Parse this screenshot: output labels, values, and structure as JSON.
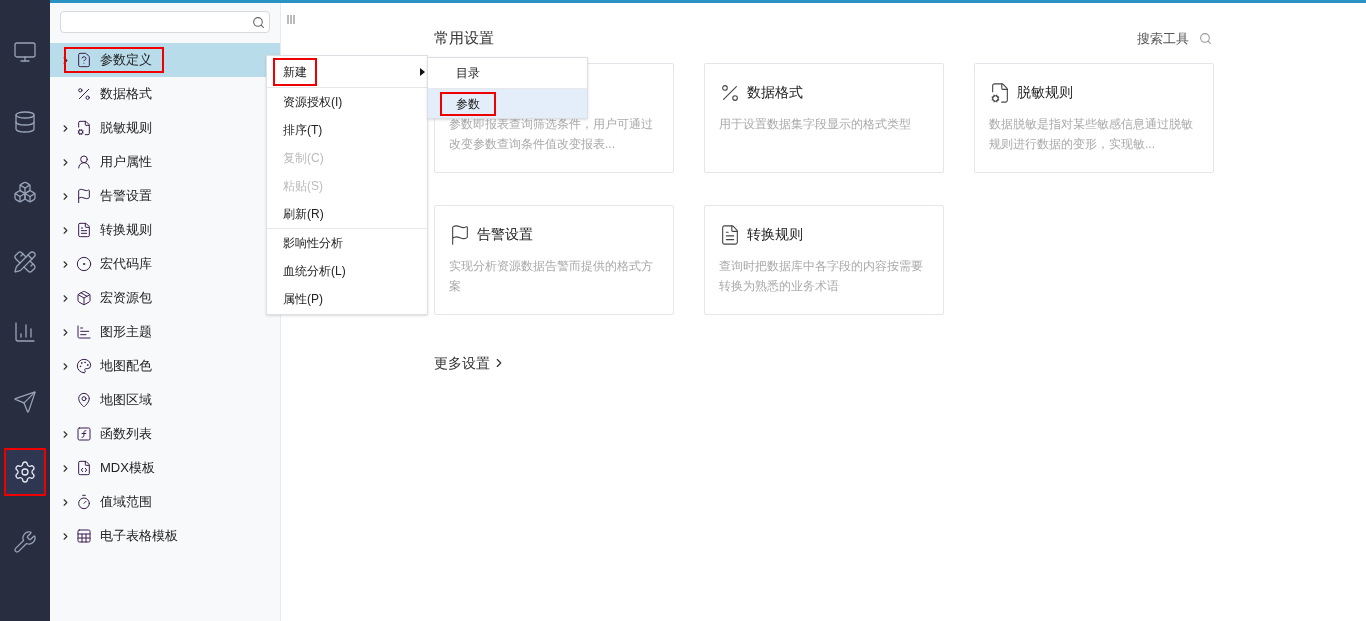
{
  "rail": [
    {
      "selected": false,
      "highlighted": false
    },
    {
      "selected": false,
      "highlighted": false
    },
    {
      "selected": false,
      "highlighted": false
    },
    {
      "selected": false,
      "highlighted": false
    },
    {
      "selected": false,
      "highlighted": false
    },
    {
      "selected": false,
      "highlighted": false
    },
    {
      "selected": true,
      "highlighted": true
    },
    {
      "selected": false,
      "highlighted": false
    }
  ],
  "tree": {
    "items": [
      {
        "label": "参数定义",
        "expandable": true,
        "selected": true,
        "highlighted": true
      },
      {
        "label": "数据格式",
        "expandable": false,
        "selected": false,
        "highlighted": false
      },
      {
        "label": "脱敏规则",
        "expandable": true,
        "selected": false,
        "highlighted": false
      },
      {
        "label": "用户属性",
        "expandable": true,
        "selected": false,
        "highlighted": false
      },
      {
        "label": "告警设置",
        "expandable": true,
        "selected": false,
        "highlighted": false
      },
      {
        "label": "转换规则",
        "expandable": true,
        "selected": false,
        "highlighted": false
      },
      {
        "label": "宏代码库",
        "expandable": true,
        "selected": false,
        "highlighted": false
      },
      {
        "label": "宏资源包",
        "expandable": true,
        "selected": false,
        "highlighted": false
      },
      {
        "label": "图形主题",
        "expandable": true,
        "selected": false,
        "highlighted": false
      },
      {
        "label": "地图配色",
        "expandable": true,
        "selected": false,
        "highlighted": false
      },
      {
        "label": "地图区域",
        "expandable": false,
        "selected": false,
        "highlighted": false
      },
      {
        "label": "函数列表",
        "expandable": true,
        "selected": false,
        "highlighted": false
      },
      {
        "label": "MDX模板",
        "expandable": true,
        "selected": false,
        "highlighted": false
      },
      {
        "label": "值域范围",
        "expandable": true,
        "selected": false,
        "highlighted": false
      },
      {
        "label": "电子表格模板",
        "expandable": true,
        "selected": false,
        "highlighted": false
      }
    ]
  },
  "context_menu": {
    "groups": [
      [
        {
          "label": "新建",
          "disabled": false,
          "highlighted": true,
          "submenu": true
        }
      ],
      [
        {
          "label": "资源授权(I)",
          "disabled": false,
          "highlighted": false,
          "submenu": false
        },
        {
          "label": "排序(T)",
          "disabled": false,
          "highlighted": false,
          "submenu": false
        },
        {
          "label": "复制(C)",
          "disabled": true,
          "highlighted": false,
          "submenu": false
        },
        {
          "label": "粘贴(S)",
          "disabled": true,
          "highlighted": false,
          "submenu": false
        },
        {
          "label": "刷新(R)",
          "disabled": false,
          "highlighted": false,
          "submenu": false
        }
      ],
      [
        {
          "label": "影响性分析",
          "disabled": false,
          "highlighted": false,
          "submenu": false
        },
        {
          "label": "血统分析(L)",
          "disabled": false,
          "highlighted": false,
          "submenu": false
        },
        {
          "label": "属性(P)",
          "disabled": false,
          "highlighted": false,
          "submenu": false
        }
      ]
    ]
  },
  "submenu": [
    {
      "label": "目录",
      "selected": false,
      "highlighted": false
    },
    {
      "label": "参数",
      "selected": true,
      "highlighted": true
    }
  ],
  "main": {
    "title": "常用设置",
    "search_label": "搜索工具",
    "cards": [
      {
        "description": "参数即报表查询筛选条件，用户可通过改变参数查询条件值改变报表..."
      },
      {
        "title": "数据格式",
        "description": "用于设置数据集字段显示的格式类型"
      },
      {
        "title": "脱敏规则",
        "description": "数据脱敏是指对某些敏感信息通过脱敏规则进行数据的变形，实现敏..."
      },
      {
        "title": "告警设置",
        "description": "实现分析资源数据告警而提供的格式方案"
      },
      {
        "title": "转换规则",
        "description": "查询时把数据库中各字段的内容按需要转换为熟悉的业务术语"
      }
    ],
    "more_link": "更多设置"
  }
}
